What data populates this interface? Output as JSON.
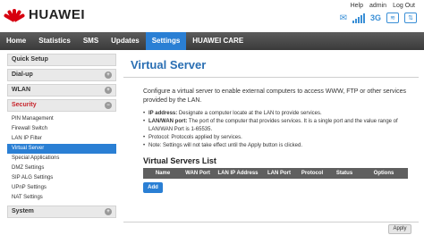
{
  "brand": {
    "name": "HUAWEI",
    "color": "#d7000f"
  },
  "toplinks": {
    "help": "Help",
    "user": "admin",
    "logout": "Log Out"
  },
  "status": {
    "network": "3G"
  },
  "nav": {
    "items": [
      {
        "label": "Home",
        "active": false
      },
      {
        "label": "Statistics",
        "active": false
      },
      {
        "label": "SMS",
        "active": false
      },
      {
        "label": "Updates",
        "active": false
      },
      {
        "label": "Settings",
        "active": true
      },
      {
        "label": "HUAWEI CARE",
        "active": false
      }
    ],
    "active_color": "#2a7fd4"
  },
  "sidebar": {
    "quick_setup": "Quick Setup",
    "dialup": "Dial-up",
    "wlan": "WLAN",
    "security": "Security",
    "security_items": [
      "PIN Management",
      "Firewall Switch",
      "LAN IP Filter",
      "Virtual Server",
      "Special Applications",
      "DMZ Settings",
      "SIP ALG Settings",
      "UPnP Settings",
      "NAT Settings"
    ],
    "system": "System"
  },
  "main": {
    "title": "Virtual Server",
    "description": "Configure a virtual server to enable external computers to access WWW, FTP or other services provided by the LAN.",
    "bullets": [
      {
        "key": "IP address:",
        "text": "Designate a computer locate at the LAN to provide services."
      },
      {
        "key": "LAN/WAN port:",
        "text": "The port of the computer that provides services. It is a single port and the value range of LAN/WAN Port is 1-65535."
      },
      {
        "key": "Protocol:",
        "text": "Protocols applied by services."
      },
      {
        "key": "Note:",
        "text": "Settings will not take effect until the Apply button is clicked."
      }
    ],
    "list_title": "Virtual Servers List",
    "columns": [
      "Name",
      "WAN Port",
      "LAN IP Address",
      "LAN Port",
      "Protocol",
      "Status",
      "Options"
    ],
    "add_label": "Add",
    "apply_label": "Apply"
  }
}
